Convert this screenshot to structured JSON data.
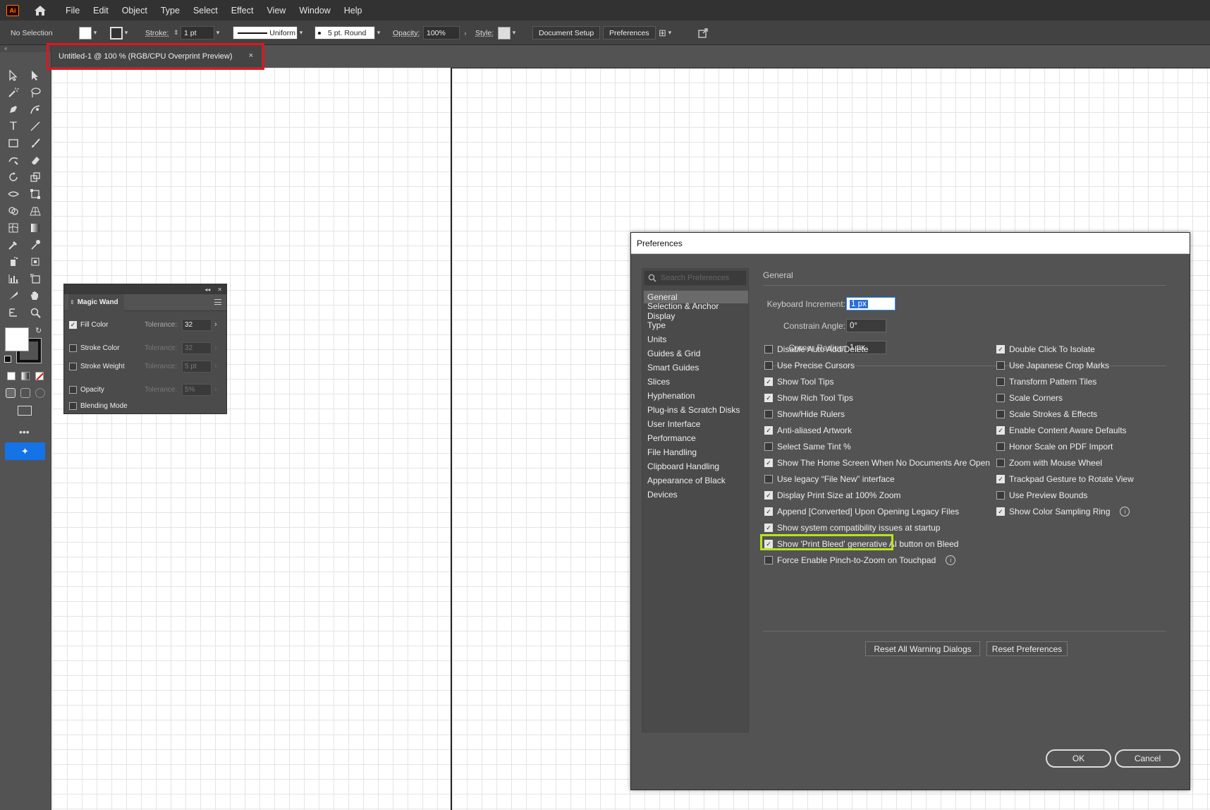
{
  "app": {
    "logo": "Ai"
  },
  "menu": [
    "File",
    "Edit",
    "Object",
    "Type",
    "Select",
    "Effect",
    "View",
    "Window",
    "Help"
  ],
  "control": {
    "selection": "No Selection",
    "stroke_label": "Stroke:",
    "stroke_weight": "1 pt",
    "profile": "Uniform",
    "brush": "5 pt. Round",
    "opacity_label": "Opacity:",
    "opacity": "100%",
    "style_label": "Style:",
    "doc_setup": "Document Setup",
    "preferences": "Preferences"
  },
  "doc_tab": {
    "title": "Untitled-1 @ 100 % (RGB/CPU Overprint Preview)",
    "close": "×"
  },
  "magic_wand": {
    "title": "Magic Wand",
    "rows": [
      {
        "label": "Fill Color",
        "checked": true,
        "tol_label": "Tolerance:",
        "tol": "32"
      },
      {
        "label": "Stroke Color",
        "checked": false,
        "tol_label": "Tolerance:",
        "tol": "32"
      },
      {
        "label": "Stroke Weight",
        "checked": false,
        "tol_label": "Tolerance:",
        "tol": "5 pt"
      },
      {
        "label": "Opacity",
        "checked": false,
        "tol_label": "Tolerance:",
        "tol": "5%"
      },
      {
        "label": "Blending Mode",
        "checked": false
      }
    ]
  },
  "prefs": {
    "title": "Preferences",
    "search_placeholder": "Search Preferences",
    "nav": [
      "General",
      "Selection & Anchor Display",
      "Type",
      "Units",
      "Guides & Grid",
      "Smart Guides",
      "Slices",
      "Hyphenation",
      "Plug-ins & Scratch Disks",
      "User Interface",
      "Performance",
      "File Handling",
      "Clipboard Handling",
      "Appearance of Black",
      "Devices"
    ],
    "section": "General",
    "keyboard_increment_label": "Keyboard Increment:",
    "keyboard_increment": "1 px",
    "constrain_angle_label": "Constrain Angle:",
    "constrain_angle": "0°",
    "corner_radius_label": "Corner Radius:",
    "corner_radius": "1 px",
    "left_options": [
      {
        "label": "Disable Auto Add/Delete",
        "checked": false
      },
      {
        "label": "Use Precise Cursors",
        "checked": false
      },
      {
        "label": "Show Tool Tips",
        "checked": true
      },
      {
        "label": "Show Rich Tool Tips",
        "checked": true
      },
      {
        "label": "Show/Hide Rulers",
        "checked": false
      },
      {
        "label": "Anti-aliased Artwork",
        "checked": true
      },
      {
        "label": "Select Same Tint %",
        "checked": false
      },
      {
        "label": "Show The Home Screen When No Documents Are Open",
        "checked": true
      },
      {
        "label": "Use legacy “File New” interface",
        "checked": false
      },
      {
        "label": "Display Print Size at 100% Zoom",
        "checked": true
      },
      {
        "label": "Append [Converted] Upon Opening Legacy Files",
        "checked": true
      },
      {
        "label": "Show system compatibility issues at startup",
        "checked": true
      },
      {
        "label": "Show 'Print Bleed' generative AI button on Bleed",
        "checked": true
      },
      {
        "label": "Force Enable Pinch-to-Zoom on Touchpad",
        "checked": false
      }
    ],
    "right_options": [
      {
        "label": "Double Click To Isolate",
        "checked": true
      },
      {
        "label": "Use Japanese Crop Marks",
        "checked": false
      },
      {
        "label": "Transform Pattern Tiles",
        "checked": false
      },
      {
        "label": "Scale Corners",
        "checked": false
      },
      {
        "label": "Scale Strokes & Effects",
        "checked": false
      },
      {
        "label": "Enable Content Aware Defaults",
        "checked": true
      },
      {
        "label": "Honor Scale on PDF Import",
        "checked": false
      },
      {
        "label": "Zoom with Mouse Wheel",
        "checked": false
      },
      {
        "label": "Trackpad Gesture to Rotate View",
        "checked": true
      },
      {
        "label": "Use Preview Bounds",
        "checked": false
      },
      {
        "label": "Show Color Sampling Ring",
        "checked": true
      }
    ],
    "info_icon": "i",
    "reset_warnings": "Reset All Warning Dialogs",
    "reset_prefs": "Reset Preferences",
    "ok": "OK",
    "cancel": "Cancel"
  },
  "colors": {
    "highlight_red": "#e6131c",
    "highlight_green": "#b6e51a",
    "accent_blue": "#1473e6"
  }
}
